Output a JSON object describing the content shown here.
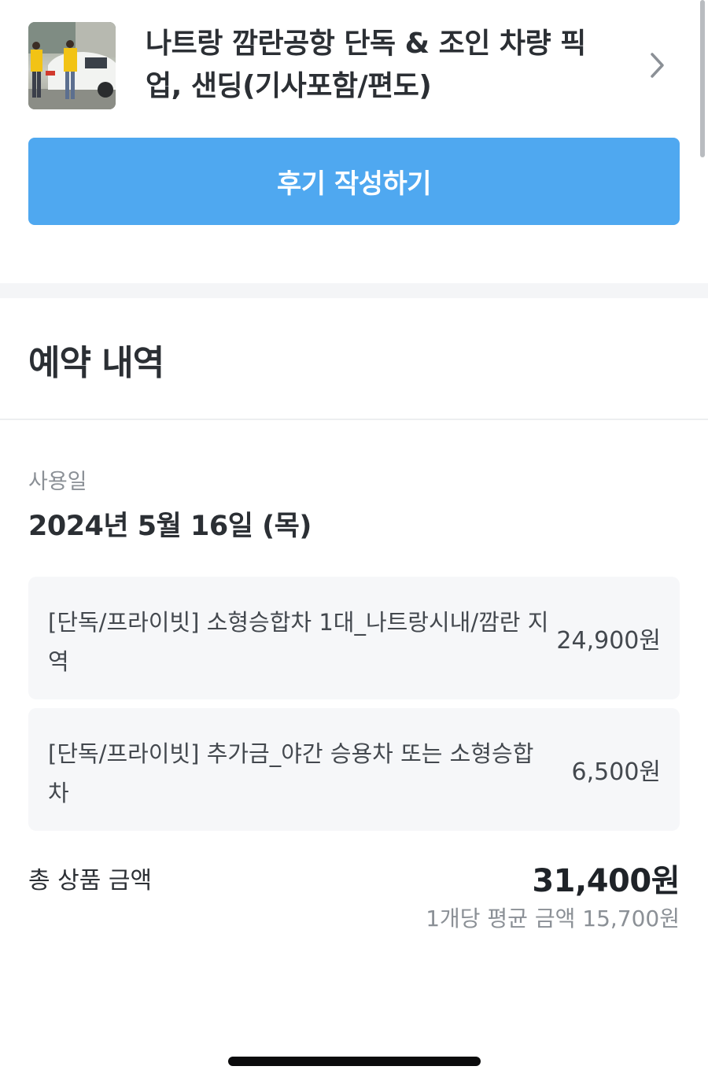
{
  "product": {
    "title": "나트랑 깜란공항 단독 & 조인 차량 픽업, 샌딩(기사포함/편도)",
    "thumbnail_alt": "airport-pickup-photo"
  },
  "review_button_label": "후기 작성하기",
  "reservation": {
    "section_title": "예약 내역",
    "use_date_label": "사용일",
    "use_date_value": "2024년 5월 16일 (목)",
    "options": [
      {
        "name": "[단독/프라이빗] 소형승합차 1대_나트랑시내/깜란 지역",
        "price": "24,900원"
      },
      {
        "name": "[단독/프라이빗] 추가금_야간 승용차 또는 소형승합차",
        "price": "6,500원"
      }
    ],
    "total_label": "총 상품 금액",
    "total_value": "31,400원",
    "average_text": "1개당 평균 금액 15,700원"
  },
  "colors": {
    "accent": "#4fa8f0",
    "divider": "#f4f5f7",
    "option_bg": "#f6f7f9"
  },
  "icons": {
    "chevron": "chevron-right-icon"
  }
}
